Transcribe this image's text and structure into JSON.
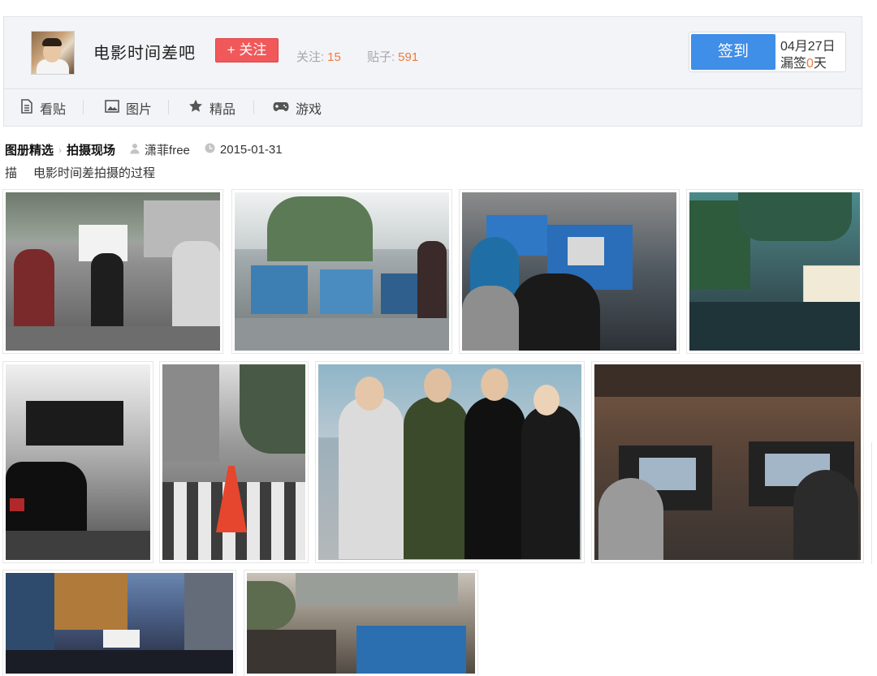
{
  "header": {
    "forum_name": "电影时间差吧",
    "follow_label": "+ 关注",
    "stats": {
      "follow_label": "关注:",
      "follow_count": "15",
      "posts_label": "贴子:",
      "posts_count": "591"
    },
    "signin": {
      "button_label": "签到",
      "date": "04月27日",
      "missed_prefix": "漏签",
      "missed_days": "0",
      "missed_suffix": "天"
    },
    "tabs": [
      {
        "label": "看贴",
        "icon": "document-icon"
      },
      {
        "label": "图片",
        "icon": "image-icon"
      },
      {
        "label": "精品",
        "icon": "star-icon"
      },
      {
        "label": "游戏",
        "icon": "gamepad-icon"
      }
    ]
  },
  "album": {
    "breadcrumb_root": "图册精选",
    "breadcrumb_current": "拍摄现场",
    "author": "潇菲free",
    "date": "2015-01-31",
    "desc_label": "描",
    "description": "电影时间差拍摄的过程"
  },
  "photos": [
    {
      "name": "photo-street-crew"
    },
    {
      "name": "photo-equipment-carts"
    },
    {
      "name": "photo-monitor-crowd"
    },
    {
      "name": "photo-filming-sign"
    },
    {
      "name": "photo-black-car-tent"
    },
    {
      "name": "photo-crosswalk-cone"
    },
    {
      "name": "photo-cast-group"
    },
    {
      "name": "photo-indoor-monitors"
    },
    {
      "name": "photo-night-stage"
    },
    {
      "name": "photo-monitor-station"
    }
  ],
  "colors": {
    "accent_blue": "#3f8ee8",
    "follow_red": "#f0585a",
    "count_orange": "#f07a3c",
    "header_bg": "#f3f4f7"
  }
}
